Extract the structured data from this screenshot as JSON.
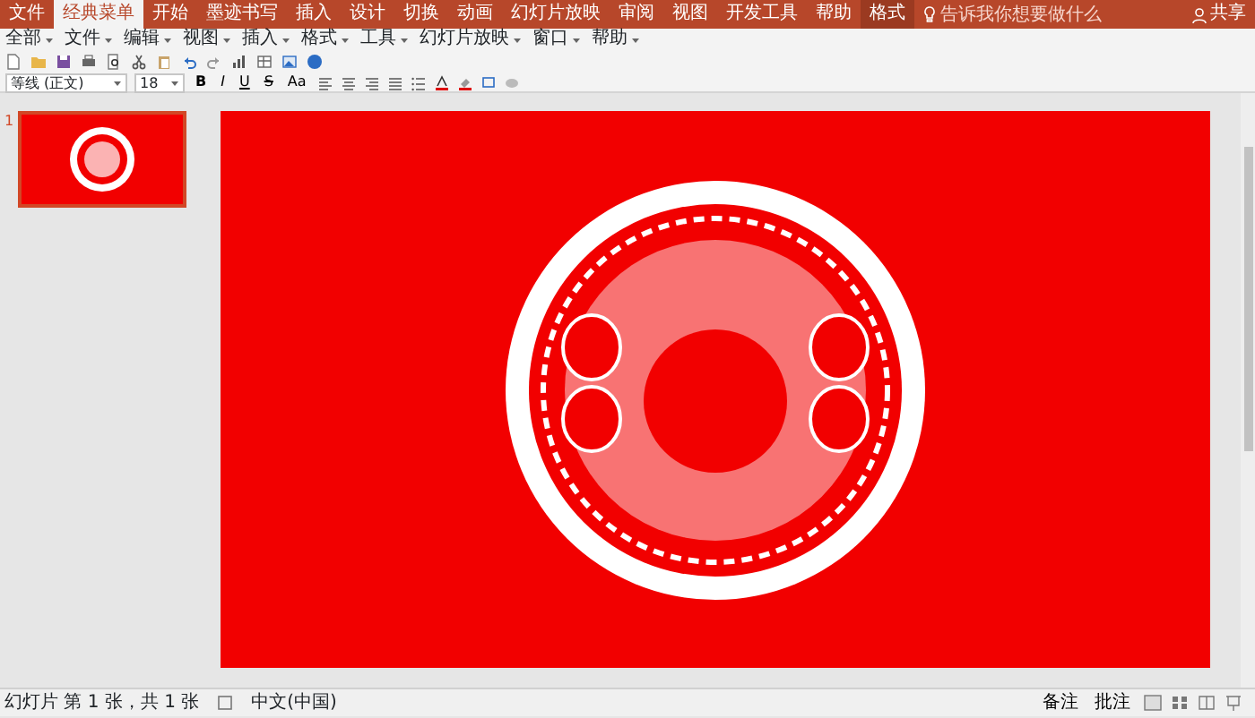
{
  "tabs": [
    {
      "label": "文件",
      "selected": false,
      "kind": "file"
    },
    {
      "label": "经典菜单",
      "selected": true,
      "kind": "normal"
    },
    {
      "label": "开始",
      "selected": false,
      "kind": "normal"
    },
    {
      "label": "墨迹书写",
      "selected": false,
      "kind": "normal"
    },
    {
      "label": "插入",
      "selected": false,
      "kind": "normal"
    },
    {
      "label": "设计",
      "selected": false,
      "kind": "normal"
    },
    {
      "label": "切换",
      "selected": false,
      "kind": "normal"
    },
    {
      "label": "动画",
      "selected": false,
      "kind": "normal"
    },
    {
      "label": "幻灯片放映",
      "selected": false,
      "kind": "normal"
    },
    {
      "label": "审阅",
      "selected": false,
      "kind": "normal"
    },
    {
      "label": "视图",
      "selected": false,
      "kind": "normal"
    },
    {
      "label": "开发工具",
      "selected": false,
      "kind": "normal"
    },
    {
      "label": "帮助",
      "selected": false,
      "kind": "normal"
    },
    {
      "label": "格式",
      "selected": false,
      "kind": "contextual"
    }
  ],
  "tell_me": {
    "placeholder": "告诉我你想要做什么"
  },
  "share": "共享",
  "menus": [
    "全部",
    "文件",
    "编辑",
    "视图",
    "插入",
    "格式",
    "工具",
    "幻灯片放映",
    "窗口",
    "帮助"
  ],
  "font_name": "等线 (正文)",
  "font_size": "18",
  "format_buttons": [
    "B",
    "I",
    "U",
    "S",
    "Aa"
  ],
  "slides": [
    {
      "number": "1",
      "selected": true
    }
  ],
  "status_bar": {
    "slide_info": "幻灯片 第 1 张，共 1 张",
    "language": "中文(中国)",
    "notes": "备注",
    "comments": "批注"
  }
}
